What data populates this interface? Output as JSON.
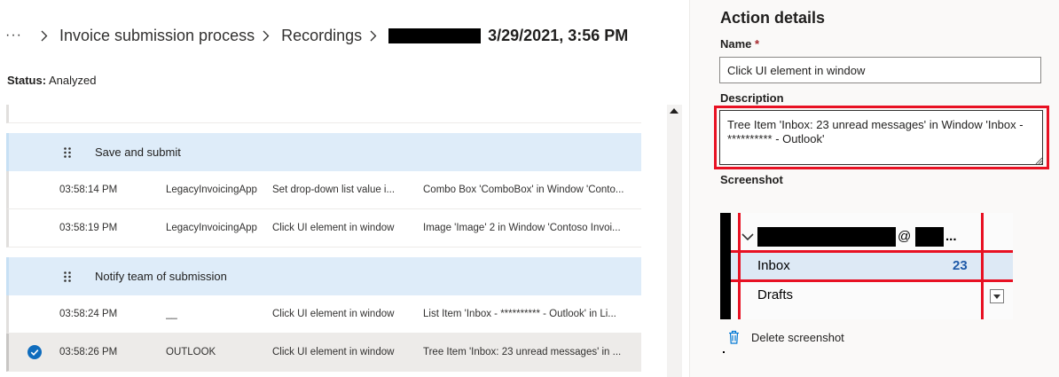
{
  "breadcrumb": {
    "overflow": "···",
    "items": [
      "Invoice submission process",
      "Recordings"
    ],
    "current": "3/29/2021, 3:56 PM"
  },
  "status": {
    "label": "Status:",
    "value": "Analyzed"
  },
  "groups": [
    {
      "title": "Save and submit",
      "rows": [
        {
          "time": "03:58:14 PM",
          "app": "LegacyInvoicingApp",
          "action": "Set drop-down list value i...",
          "target": "Combo Box 'ComboBox' in Window 'Conto...",
          "selected": false
        },
        {
          "time": "03:58:19 PM",
          "app": "LegacyInvoicingApp",
          "action": "Click UI element in window",
          "target": "Image 'Image' 2 in Window 'Contoso Invoi...",
          "selected": false
        }
      ]
    },
    {
      "title": "Notify team of submission",
      "rows": [
        {
          "time": "03:58:24 PM",
          "app": "__",
          "action": "Click UI element in window",
          "target": "List Item 'Inbox - ********** - Outlook' in Li...",
          "selected": false
        },
        {
          "time": "03:58:26 PM",
          "app": "OUTLOOK",
          "action": "Click UI element in window",
          "target": "Tree Item 'Inbox: 23 unread messages' in ...",
          "selected": true
        }
      ]
    }
  ],
  "details": {
    "title": "Action details",
    "name_label": "Name",
    "required_mark": "*",
    "name_value": "Click UI element in window",
    "description_label": "Description",
    "description_value": "Tree Item 'Inbox: 23 unread messages' in Window 'Inbox - ********** - Outlook'",
    "screenshot_label": "Screenshot",
    "screenshot": {
      "account_at": "@",
      "account_ellipsis": "...",
      "inbox_label": "Inbox",
      "inbox_count": "23",
      "drafts_label": "Drafts"
    },
    "delete_label": "Delete screenshot"
  },
  "colors": {
    "group_bg": "#deecf9",
    "selected_row_bg": "#edebe9",
    "check_blue": "#0f6cbd",
    "highlight_red": "#e81123",
    "panel_bg": "#faf9f8",
    "delete_icon": "#0078d4"
  },
  "icons": {
    "overflow": "ellipsis-icon",
    "separator": "chevron-right-icon",
    "group_handle": "drag-handle-icon",
    "row_selected": "checkmark-circle-icon",
    "scroll_up": "scroll-up-arrow-icon",
    "delete": "trash-icon"
  }
}
